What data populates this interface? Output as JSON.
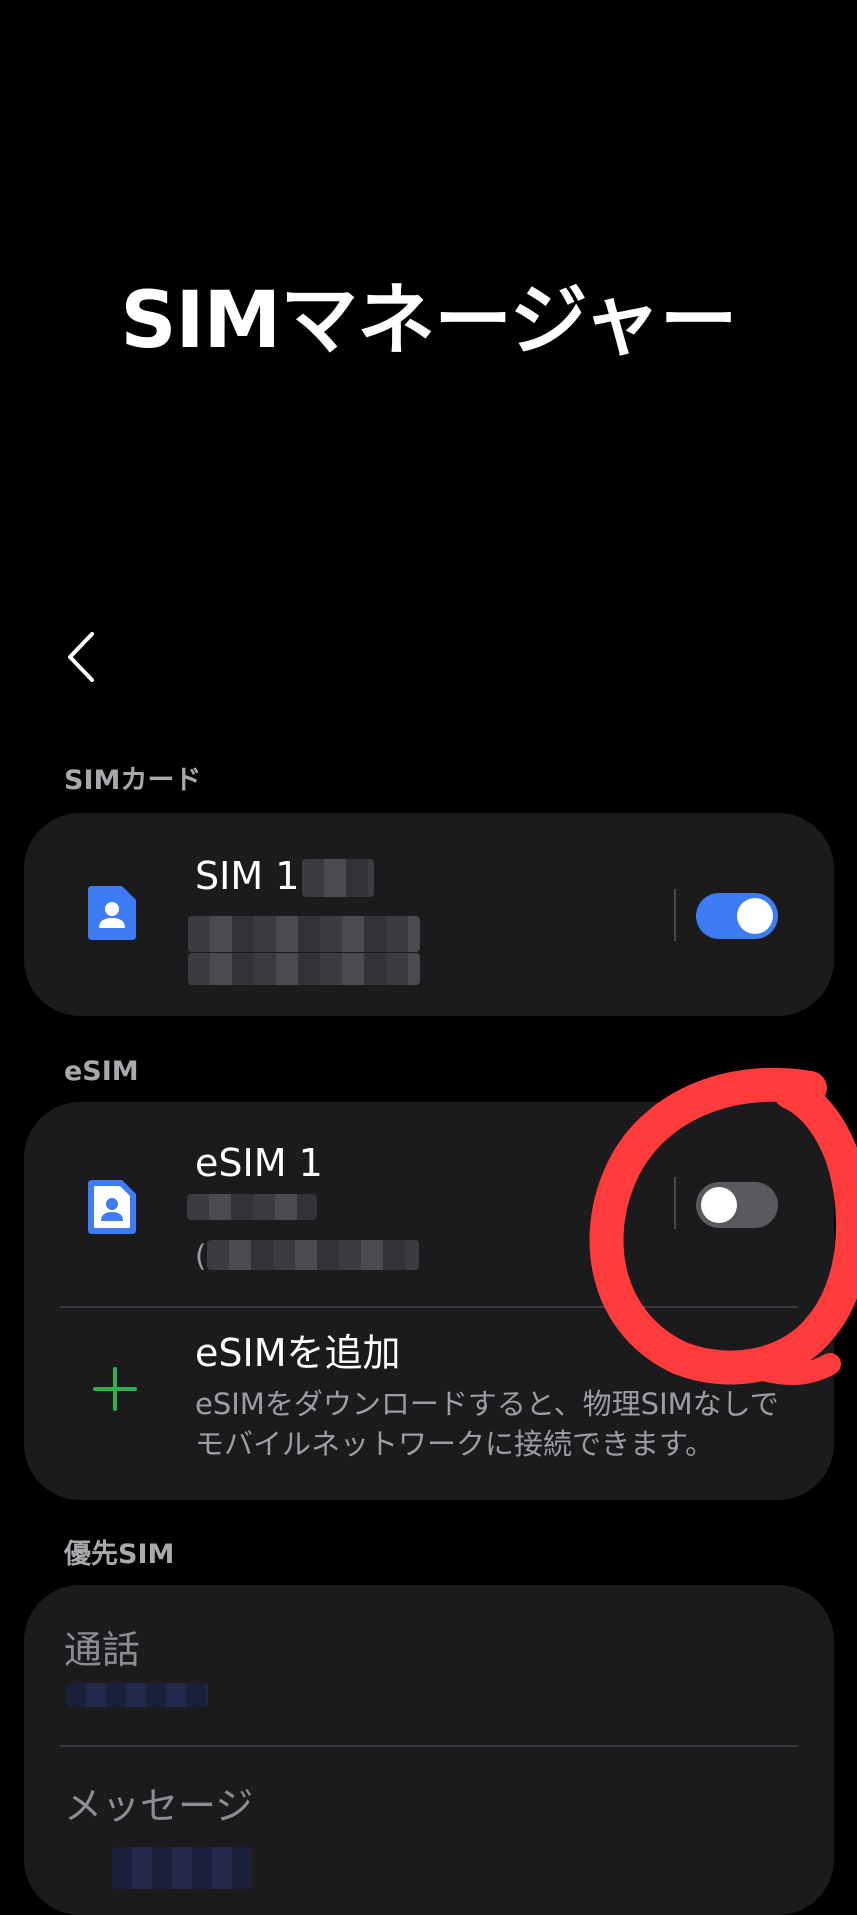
{
  "header": {
    "title": "SIMマネージャー"
  },
  "sections": {
    "sim_card_label": "SIMカード",
    "esim_label": "eSIM",
    "preferred_label": "優先SIM"
  },
  "sim1": {
    "title": "SIM 1",
    "toggle_state": "on"
  },
  "esim1": {
    "title": "eSIM 1",
    "sub_visible": "(",
    "toggle_state": "off"
  },
  "add_esim": {
    "title": "eSIMを追加",
    "description_line1": "eSIMをダウンロードすると、物理SIMなしで",
    "description_line2": "モバイルネットワークに接続できます。"
  },
  "preferred": {
    "call_label": "通話",
    "message_label": "メッセージ"
  },
  "colors": {
    "background": "#000000",
    "card": "#1b1b1d",
    "accent_toggle_on": "#3e7cf6",
    "sim_icon": "#3e7cf6",
    "add_plus": "#2fb14f",
    "annotation": "#ff3b3b"
  },
  "icons": {
    "back": "chevron-left-icon",
    "sim": "sim-card-icon",
    "add": "plus-icon"
  }
}
